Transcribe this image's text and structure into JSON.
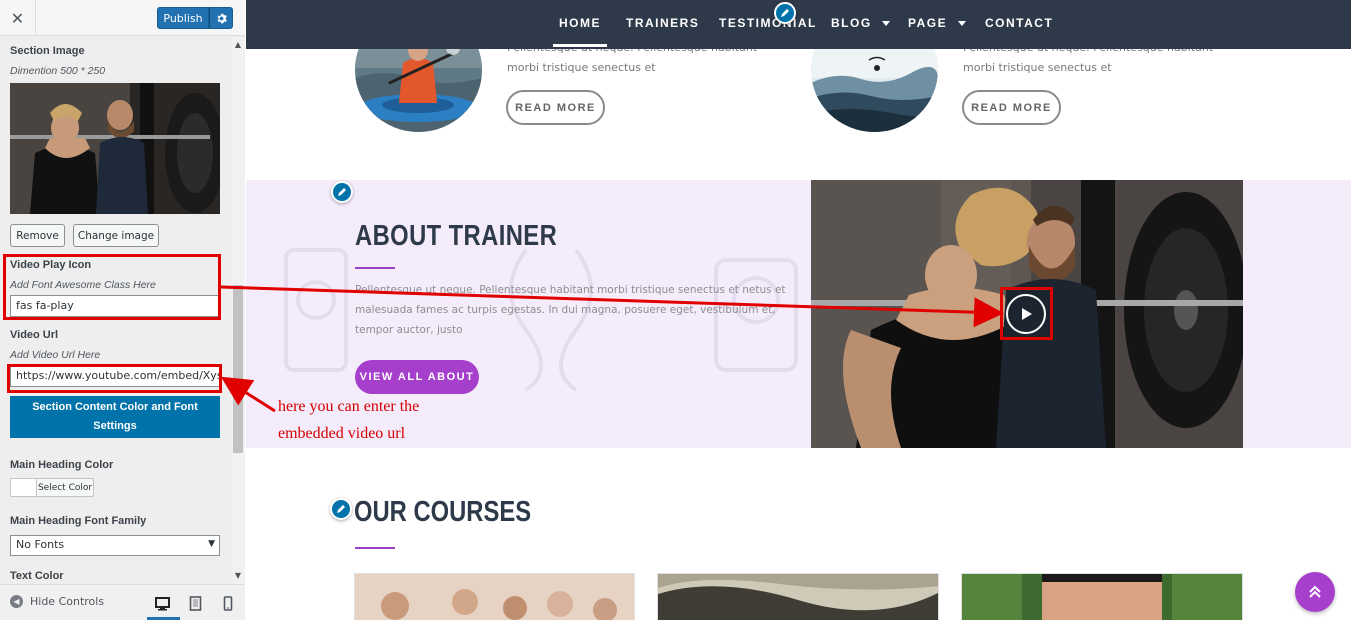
{
  "customizer": {
    "close_label": "✕",
    "publish_label": "Publish",
    "publish_settings_icon": "gear-icon",
    "section_image": {
      "label": "Section Image",
      "description": "Dimention 500 * 250",
      "remove_label": "Remove",
      "change_label": "Change image"
    },
    "video_play_icon": {
      "label": "Video Play Icon",
      "description": "Add Font Awesome Class Here",
      "value": "fas fa-play"
    },
    "video_url": {
      "label": "Video Url",
      "description": "Add Video Url Here",
      "value": "https://www.youtube.com/embed/XysRh"
    },
    "content_settings_button": "Section Content Color and Font Settings",
    "main_heading_color": {
      "label": "Main Heading Color",
      "select_label": "Select Color"
    },
    "main_heading_font": {
      "label": "Main Heading Font Family",
      "value": "No Fonts"
    },
    "text_color_label": "Text Color",
    "footer": {
      "hide_controls_label": "Hide Controls",
      "devices": [
        "desktop",
        "tablet",
        "mobile"
      ]
    }
  },
  "site": {
    "nav": [
      "HOME",
      "TRAINERS",
      "TESTIMONIAL",
      "BLOG",
      "PAGE",
      "CONTACT"
    ],
    "blog_cards": [
      {
        "text_line1": "Pellentesque ut neque. Pellentesque habitant",
        "text_line2": "morbi tristique senectus et",
        "button": "READ MORE"
      },
      {
        "text_line1": "Pellentesque ut neque. Pellentesque habitant",
        "text_line2": "morbi tristique senectus et",
        "button": "READ MORE"
      }
    ],
    "about": {
      "title": "ABOUT TRAINER",
      "text": "Pellentesque ut neque. Pellentesque habitant morbi tristique senectus et netus et malesuada fames ac turpis egestas. In dui magna, posuere eget, vestibulum et, tempor auctor, justo",
      "button": "VIEW ALL ABOUT"
    },
    "courses": {
      "title": "OUR COURSES"
    }
  },
  "annotation": {
    "line1": "here you can enter the",
    "line2": "embedded video url"
  },
  "colors": {
    "accent": "#a63fcb",
    "nav_bg": "#2e3a4a",
    "wp_blue": "#2271b1",
    "annotation_red": "#e00000"
  }
}
